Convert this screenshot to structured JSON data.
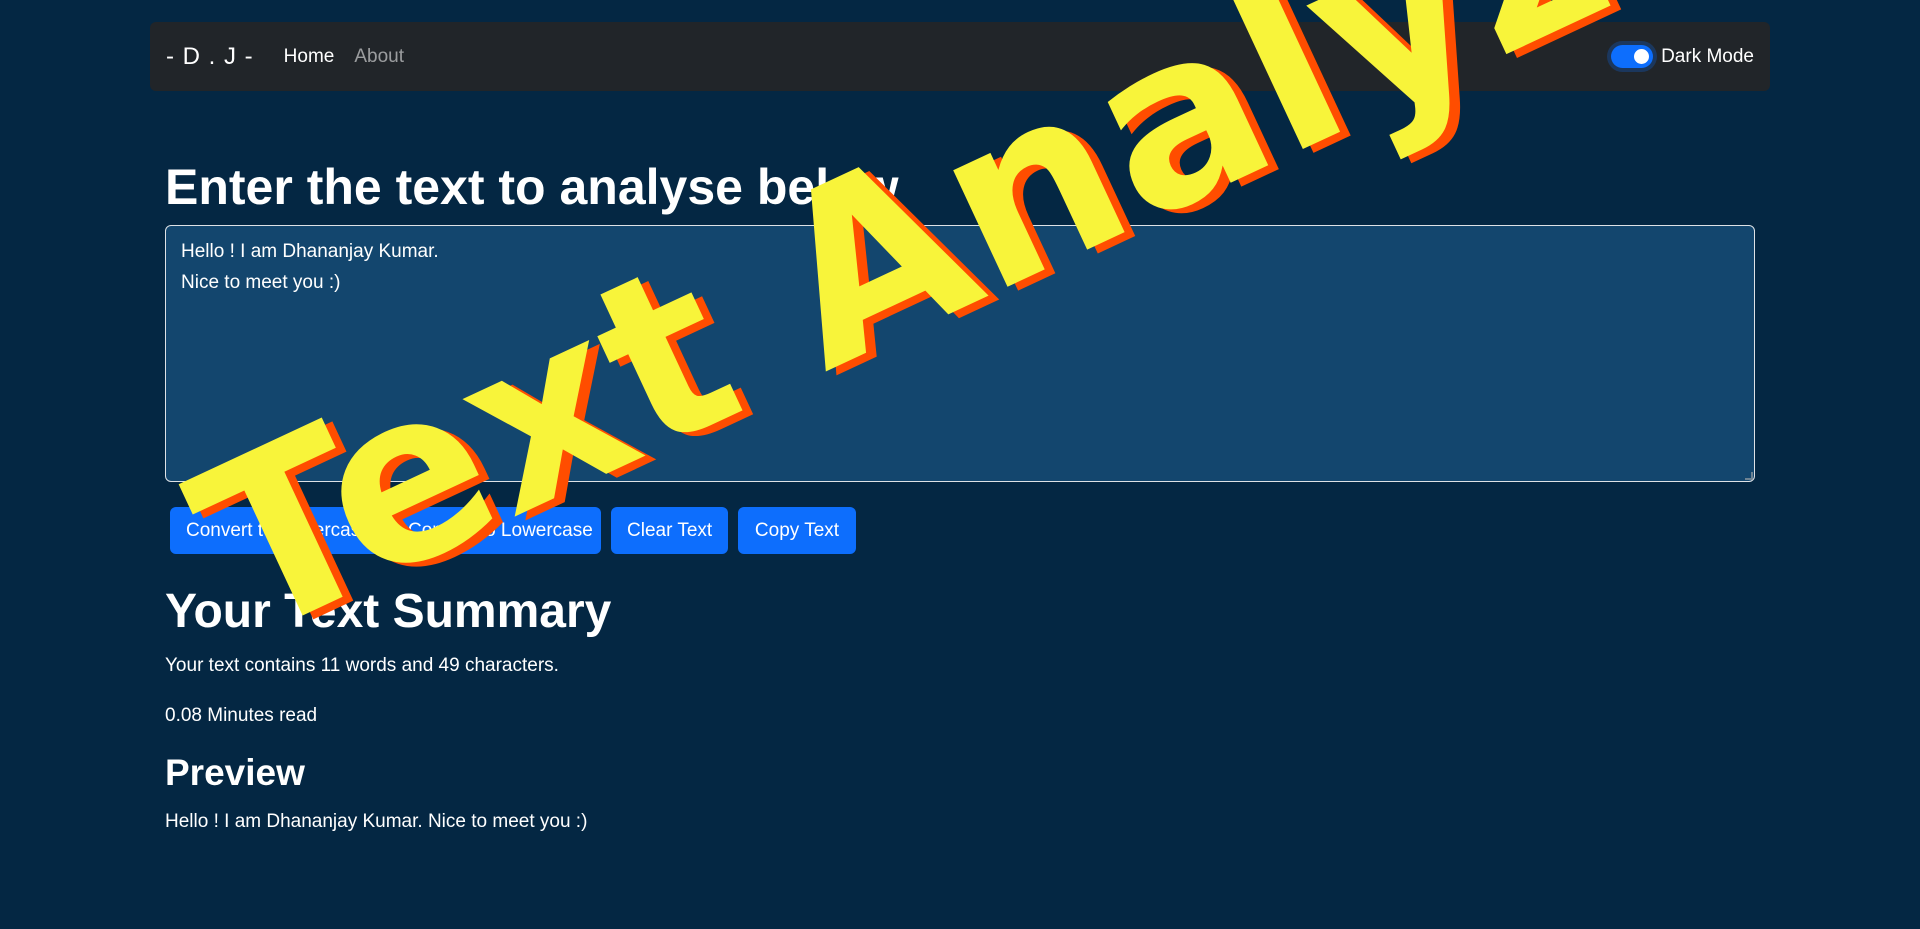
{
  "navbar": {
    "brand": "- D . J -",
    "links": [
      {
        "label": "Home",
        "active": true
      },
      {
        "label": "About",
        "active": false
      }
    ],
    "toggle": {
      "label": "Dark Mode",
      "checked": true
    }
  },
  "main": {
    "heading": "Enter the text to analyse below",
    "textarea_value": "Hello ! I am Dhananjay Kumar.\nNice to meet you :)",
    "buttons": {
      "uppercase": "Convert to Uppercase",
      "lowercase": "Convert to Lowercase",
      "clear": "Clear Text",
      "copy": "Copy Text"
    }
  },
  "summary": {
    "heading": "Your Text Summary",
    "counts": "Your text contains 11 words and 49 characters.",
    "read_time": "0.08 Minutes read"
  },
  "preview": {
    "heading": "Preview",
    "text": "Hello ! I am Dhananjay Kumar. Nice to meet you :)"
  },
  "banner": {
    "text": "Text Analyzer",
    "fill": "#f8f43a",
    "shadow": "#ff4d00"
  },
  "colors": {
    "background": "#042743",
    "navbar": "#212529",
    "textarea": "#13466e",
    "button": "#0d6efd"
  }
}
